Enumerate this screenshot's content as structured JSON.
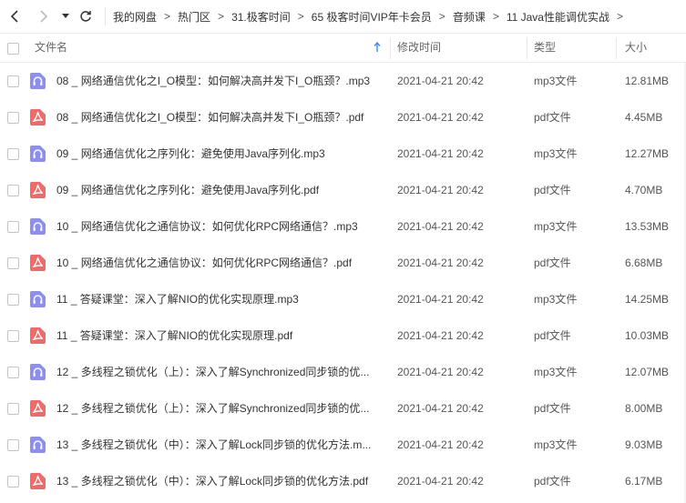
{
  "nav": {
    "breadcrumb": [
      "我的网盘",
      "热门区",
      "31.极客时间",
      "65 极客时间VIP年卡会员",
      "音频课",
      "11 Java性能调优实战"
    ],
    "separator": ">"
  },
  "header": {
    "name": "文件名",
    "modified": "修改时间",
    "type": "类型",
    "size": "大小"
  },
  "colors": {
    "mp3_icon": "#8b8ff0",
    "pdf_icon": "#f06a6a",
    "accent": "#3b8cf0"
  },
  "files": [
    {
      "name": "08 _ 网络通信优化之I_O模型：如何解决高并发下I_O瓶颈？.mp3",
      "date": "2021-04-21 20:42",
      "type": "mp3文件",
      "size": "12.81MB",
      "icon": "audio-file-icon"
    },
    {
      "name": "08 _ 网络通信优化之I_O模型：如何解决高并发下I_O瓶颈？.pdf",
      "date": "2021-04-21 20:42",
      "type": "pdf文件",
      "size": "4.45MB",
      "icon": "pdf-file-icon"
    },
    {
      "name": "09 _ 网络通信优化之序列化：避免使用Java序列化.mp3",
      "date": "2021-04-21 20:42",
      "type": "mp3文件",
      "size": "12.27MB",
      "icon": "audio-file-icon"
    },
    {
      "name": "09 _ 网络通信优化之序列化：避免使用Java序列化.pdf",
      "date": "2021-04-21 20:42",
      "type": "pdf文件",
      "size": "4.70MB",
      "icon": "pdf-file-icon"
    },
    {
      "name": "10 _ 网络通信优化之通信协议：如何优化RPC网络通信？.mp3",
      "date": "2021-04-21 20:42",
      "type": "mp3文件",
      "size": "13.53MB",
      "icon": "audio-file-icon"
    },
    {
      "name": "10 _ 网络通信优化之通信协议：如何优化RPC网络通信？.pdf",
      "date": "2021-04-21 20:42",
      "type": "pdf文件",
      "size": "6.68MB",
      "icon": "pdf-file-icon"
    },
    {
      "name": "11 _ 答疑课堂：深入了解NIO的优化实现原理.mp3",
      "date": "2021-04-21 20:42",
      "type": "mp3文件",
      "size": "14.25MB",
      "icon": "audio-file-icon"
    },
    {
      "name": "11 _ 答疑课堂：深入了解NIO的优化实现原理.pdf",
      "date": "2021-04-21 20:42",
      "type": "pdf文件",
      "size": "10.03MB",
      "icon": "pdf-file-icon"
    },
    {
      "name": "12 _ 多线程之锁优化（上）：深入了解Synchronized同步锁的优...",
      "date": "2021-04-21 20:42",
      "type": "mp3文件",
      "size": "12.07MB",
      "icon": "audio-file-icon"
    },
    {
      "name": "12 _ 多线程之锁优化（上）：深入了解Synchronized同步锁的优...",
      "date": "2021-04-21 20:42",
      "type": "pdf文件",
      "size": "8.00MB",
      "icon": "pdf-file-icon"
    },
    {
      "name": "13 _ 多线程之锁优化（中）：深入了解Lock同步锁的优化方法.m...",
      "date": "2021-04-21 20:42",
      "type": "mp3文件",
      "size": "9.03MB",
      "icon": "audio-file-icon"
    },
    {
      "name": "13 _ 多线程之锁优化（中）：深入了解Lock同步锁的优化方法.pdf",
      "date": "2021-04-21 20:42",
      "type": "pdf文件",
      "size": "6.17MB",
      "icon": "pdf-file-icon"
    }
  ]
}
